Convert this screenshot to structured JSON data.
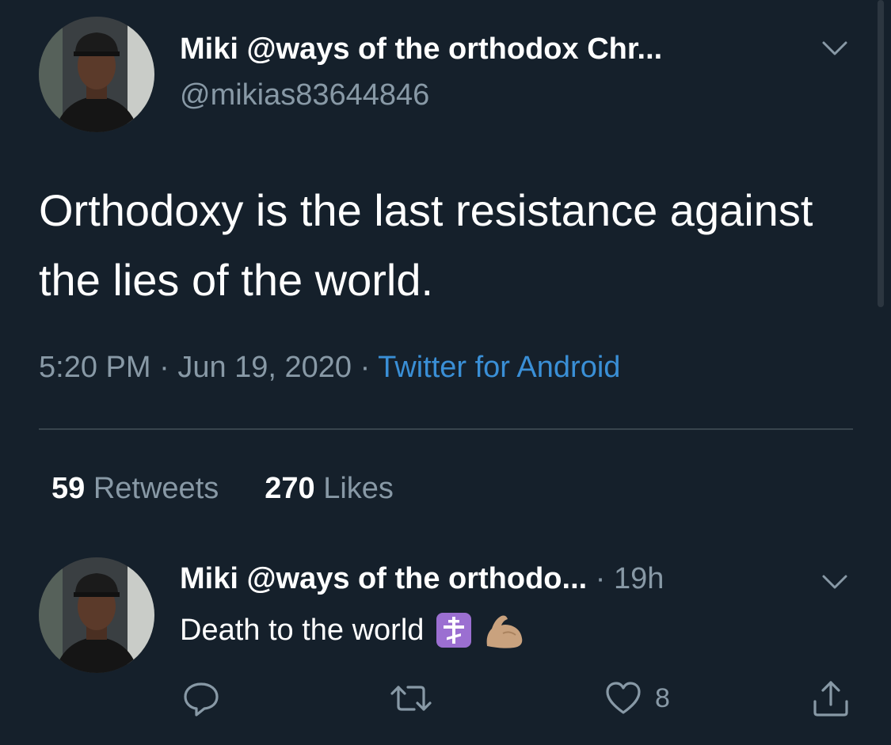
{
  "tweet": {
    "display_name": "Miki @ways of the orthodox Chr...",
    "handle": "@mikias83644846",
    "text": "Orthodoxy is the last resistance against the lies of the world.",
    "time": "5:20 PM",
    "date": "Jun 19, 2020",
    "separator": "·",
    "source": "Twitter for Android",
    "retweets_count": "59",
    "retweets_label": "Retweets",
    "likes_count": "270",
    "likes_label": "Likes",
    "menu_icon": "chevron-down-icon",
    "avatar_icon": "profile-photo"
  },
  "reply": {
    "display_name": "Miki @ways of the orthodo...",
    "time": "· 19h",
    "text": "Death to the world",
    "emojis": [
      "orthodox-cross-emoji",
      "flexed-biceps-emoji"
    ],
    "like_count": "8",
    "actions": [
      "reply-icon",
      "retweet-icon",
      "heart-icon",
      "share-icon"
    ]
  },
  "colors": {
    "background": "#15202b",
    "primary_text": "#ffffff",
    "secondary_text": "#8899a6",
    "link": "#3a8fd6",
    "divider": "#38444d",
    "emoji_cross_bg": "#9b6fd1",
    "emoji_arm": "#c9a27e"
  }
}
